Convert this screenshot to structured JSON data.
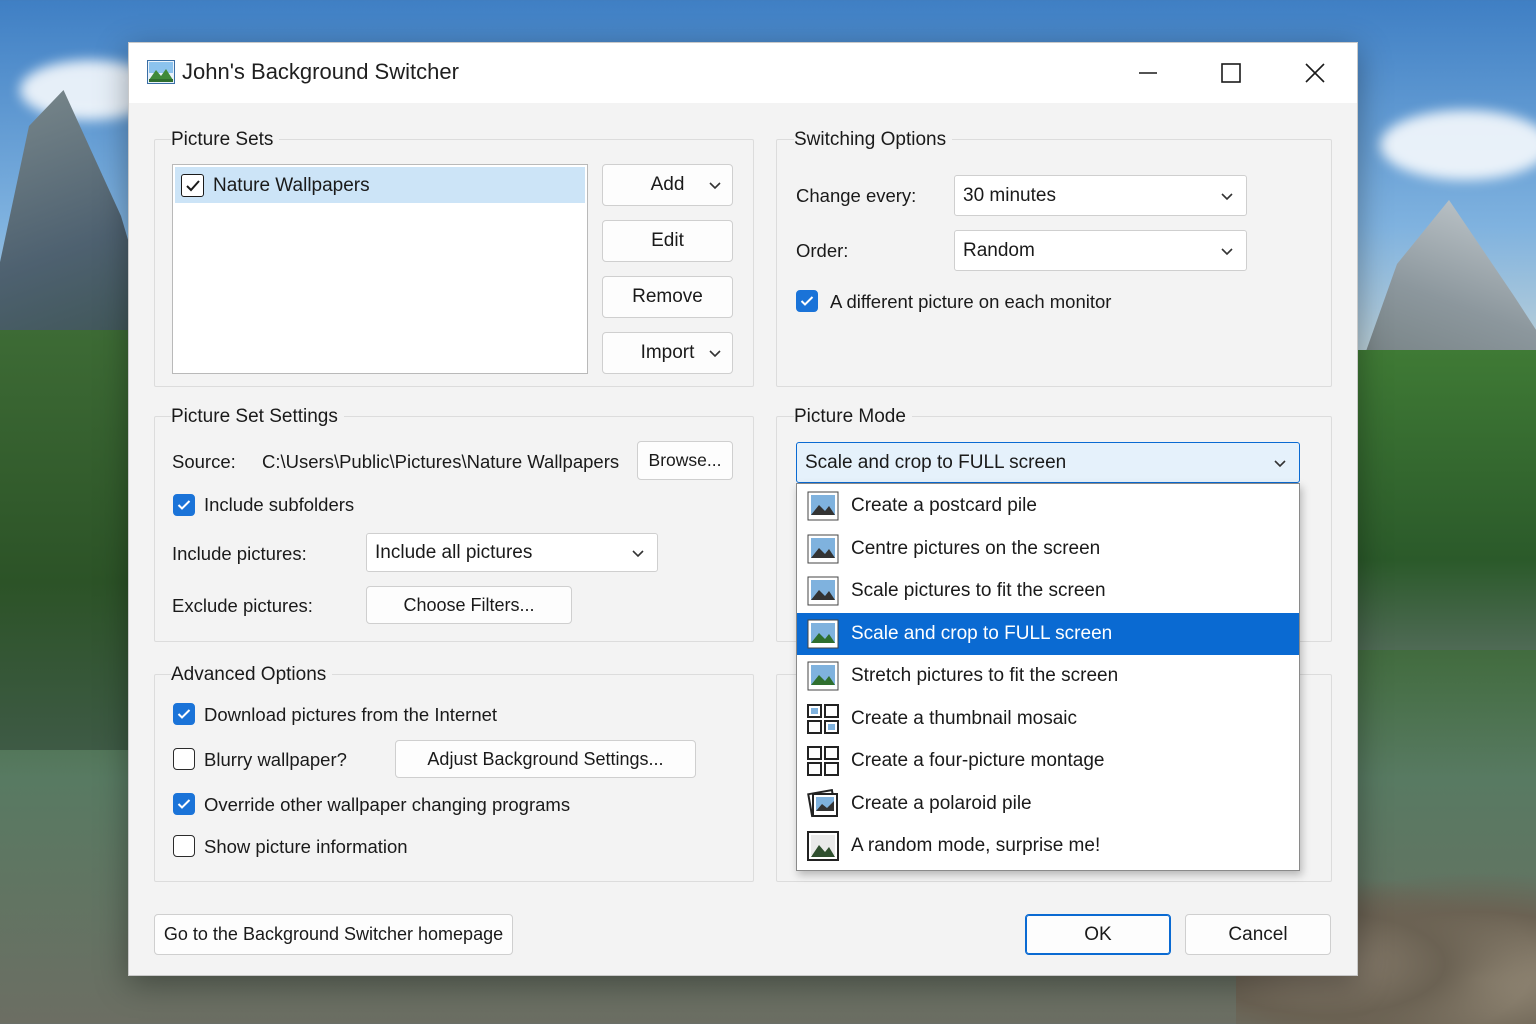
{
  "window": {
    "title": "John's Background Switcher"
  },
  "picture_sets": {
    "title": "Picture Sets",
    "items": [
      {
        "label": "Nature Wallpapers",
        "checked": true
      }
    ],
    "buttons": {
      "add": "Add",
      "edit": "Edit",
      "remove": "Remove",
      "import": "Import"
    }
  },
  "switching": {
    "title": "Switching Options",
    "change_every_label": "Change every:",
    "change_every_value": "30 minutes",
    "order_label": "Order:",
    "order_value": "Random",
    "different_per_monitor": "A different picture on each monitor"
  },
  "set_settings": {
    "title": "Picture Set Settings",
    "source_label": "Source:",
    "source_value": "C:\\Users\\Public\\Pictures\\Nature Wallpapers",
    "browse": "Browse...",
    "include_subfolders": "Include subfolders",
    "include_label": "Include pictures:",
    "include_value": "Include all pictures",
    "exclude_label": "Exclude pictures:",
    "choose_filters": "Choose Filters..."
  },
  "picture_mode": {
    "title": "Picture Mode",
    "selected": "Scale and crop to FULL screen",
    "options": [
      {
        "label": "Create a postcard pile",
        "icon": "postcard-icon"
      },
      {
        "label": "Centre pictures on the screen",
        "icon": "centre-icon"
      },
      {
        "label": "Scale pictures to fit the screen",
        "icon": "scale-icon"
      },
      {
        "label": "Scale and crop to FULL screen",
        "icon": "crop-icon",
        "selected": true
      },
      {
        "label": "Stretch pictures to fit the screen",
        "icon": "stretch-icon"
      },
      {
        "label": "Create a thumbnail mosaic",
        "icon": "mosaic-icon"
      },
      {
        "label": "Create a four-picture montage",
        "icon": "montage-icon"
      },
      {
        "label": "Create a polaroid pile",
        "icon": "polaroid-icon"
      },
      {
        "label": "A random mode, surprise me!",
        "icon": "random-icon"
      }
    ]
  },
  "advanced": {
    "title": "Advanced Options",
    "download": "Download pictures from the Internet",
    "blurry": "Blurry wallpaper?",
    "adjust": "Adjust Background Settings...",
    "override": "Override other wallpaper changing programs",
    "show_info": "Show picture information"
  },
  "footer": {
    "homepage": "Go to the Background Switcher homepage",
    "ok": "OK",
    "cancel": "Cancel"
  },
  "colors": {
    "accent": "#1a73d8",
    "selection": "#0a6ad2",
    "list_selection": "#cce4f7"
  }
}
